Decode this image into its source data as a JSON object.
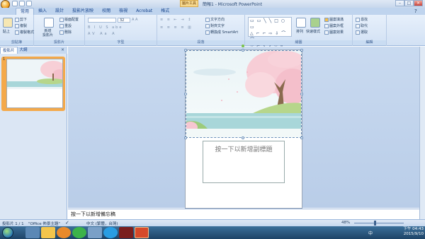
{
  "window": {
    "title": "簡報1 - Microsoft PowerPoint",
    "context_tab": "圖片工具"
  },
  "tabs": [
    "常用",
    "插入",
    "設計",
    "投影片放映",
    "校閱",
    "檢視",
    "Acrobat",
    "格式"
  ],
  "ribbon": {
    "clipboard": {
      "paste": "貼上",
      "cut": "剪下",
      "copy": "複製",
      "format_painter": "複製格式",
      "label": "剪貼簿"
    },
    "slides": {
      "new_slide": "新增\n投影片",
      "layout": "版面配置",
      "reset": "重設",
      "delete": "刪除",
      "label": "投影片"
    },
    "font": {
      "size": "32",
      "label": "字型"
    },
    "paragraph": {
      "text_direction": "文字方向",
      "align_text": "對齊文字",
      "smartart": "轉換成 SmartArt",
      "label": "段落"
    },
    "drawing": {
      "arrange": "排列",
      "quick_styles": "快速樣式",
      "shape_fill": "圖案填滿",
      "shape_outline": "圖案外框",
      "shape_effects": "圖案效果",
      "label": "繪圖"
    },
    "editing": {
      "find": "尋找",
      "replace": "取代",
      "select": "選取",
      "label": "編輯"
    }
  },
  "left_panel": {
    "tab_slides": "投影片",
    "tab_outline": "大綱",
    "close": "×",
    "slide_number": "1"
  },
  "slide": {
    "subtitle_placeholder": "按一下以新增副標題"
  },
  "notes": {
    "placeholder": "按一下以新增備忘稿"
  },
  "status": {
    "slide_info": "投影片 1 / 1",
    "theme": "\"Office 佈景主題\"",
    "language": "中文 (繁體，台灣)",
    "zoom": "48%"
  },
  "taskbar": {
    "time": "下午 04:43",
    "date": "2015/9/10",
    "ime": "中"
  },
  "colors": {
    "ribbon": "#dfe9f5",
    "accent": "#f4a94a",
    "taskbar": "#2a5580"
  }
}
